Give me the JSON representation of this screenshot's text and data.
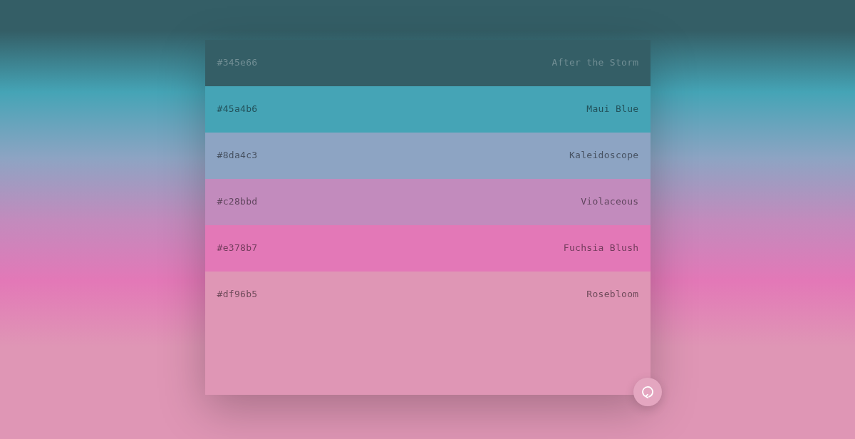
{
  "palette": [
    {
      "hex": "#345e66",
      "name": "After the Storm",
      "color": "#345e66"
    },
    {
      "hex": "#45a4b6",
      "name": "Maui Blue",
      "color": "#45a4b6"
    },
    {
      "hex": "#8da4c3",
      "name": "Kaleidoscope",
      "color": "#8da4c3"
    },
    {
      "hex": "#c28bbd",
      "name": "Violaceous",
      "color": "#c28bbd"
    },
    {
      "hex": "#e378b7",
      "name": "Fuchsia Blush",
      "color": "#e378b7"
    },
    {
      "hex": "#df96b5",
      "name": "Rosebloom",
      "color": "#df96b5"
    }
  ]
}
